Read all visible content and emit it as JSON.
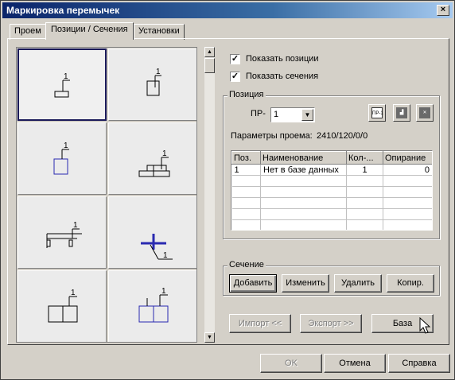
{
  "window": {
    "title": "Маркировка перемычек",
    "close_label": "×"
  },
  "tabs": [
    {
      "label": "Проем"
    },
    {
      "label": "Позиции / Сечения"
    },
    {
      "label": "Установки"
    }
  ],
  "grid": {
    "cells": [
      {
        "label": "1"
      },
      {
        "label": "1"
      },
      {
        "label": "1"
      },
      {
        "label": "1"
      },
      {
        "label": "1"
      },
      {
        "label": "1"
      },
      {
        "label": "1"
      },
      {
        "label": "1"
      }
    ]
  },
  "options": {
    "show_positions": {
      "label": "Показать позиции",
      "checked": "✓"
    },
    "show_sections": {
      "label": "Показать сечения",
      "checked": "✓"
    }
  },
  "position": {
    "group_label": "Позиция",
    "pr_label": "ПР-",
    "pr_value": "1",
    "icon_label": "ПР-1",
    "params_label": "Параметры проема:",
    "params_value": "2410/120/0/0",
    "table": {
      "headers": [
        "Поз.",
        "Наименование",
        "Кол-...",
        "Опирание"
      ],
      "rows": [
        [
          "1",
          "Нет в базе данных",
          "1",
          "0"
        ]
      ]
    }
  },
  "section": {
    "group_label": "Сечение",
    "add": "Добавить",
    "edit": "Изменить",
    "delete": "Удалить",
    "copy": "Копир."
  },
  "actions": {
    "import": "Импорт <<",
    "export": "Экспорт >>",
    "base": "База"
  },
  "footer": {
    "ok": "OK",
    "cancel": "Отмена",
    "help": "Справка"
  },
  "colors": {
    "title_start": "#0a246a",
    "title_end": "#a6caf0",
    "selection": "#1a1a5a",
    "blue_symbol": "#2a2ab0"
  }
}
